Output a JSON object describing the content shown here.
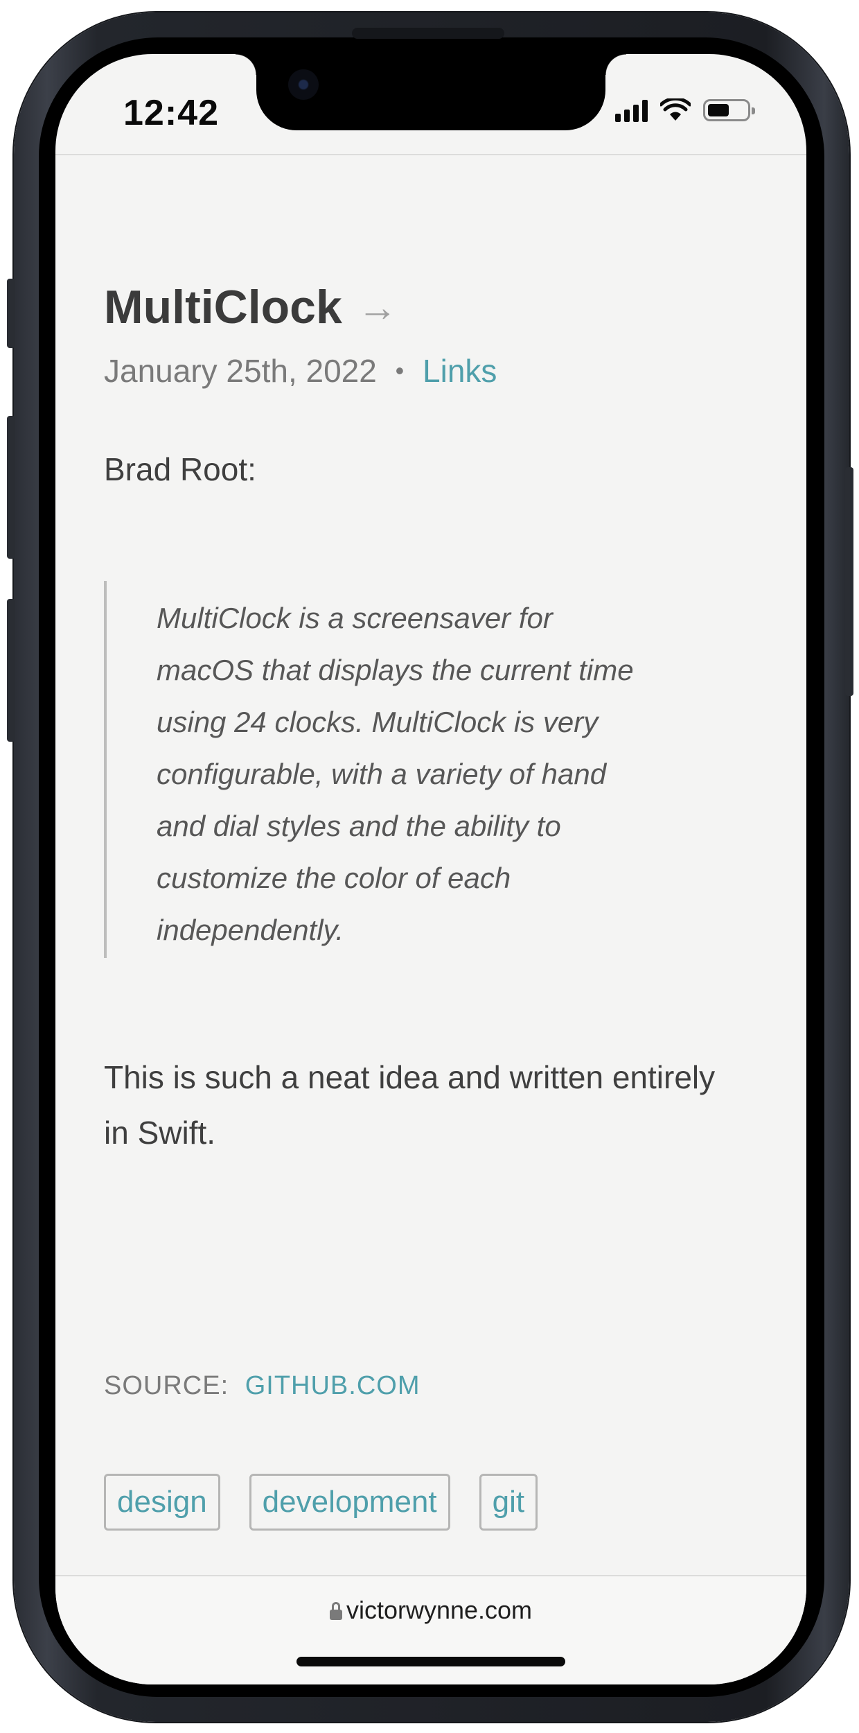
{
  "status_bar": {
    "time": "12:42",
    "battery_level": 0.55
  },
  "post": {
    "title": "MultiClock",
    "title_arrow": "→",
    "date": "January 25th, 2022",
    "separator": "•",
    "category": "Links",
    "author_intro": "Brad Root:",
    "quote_lines": [
      "MultiClock is a screensaver for",
      "macOS that displays the current time",
      "using 24 clocks. MultiClock is very",
      "configurable, with a variety of hand",
      "and dial styles and the ability to",
      "customize the color of each",
      "independently."
    ],
    "body_lines": [
      "This is such a neat idea and written entirely",
      "in Swift."
    ],
    "source_label": "SOURCE:",
    "source_link": "GITHUB.COM",
    "tags": [
      "design",
      "development",
      "git"
    ]
  },
  "browser": {
    "url": "victorwynne.com"
  },
  "colors": {
    "link": "#4f9fab",
    "background": "#f4f4f3",
    "text": "#3f3f3f"
  }
}
